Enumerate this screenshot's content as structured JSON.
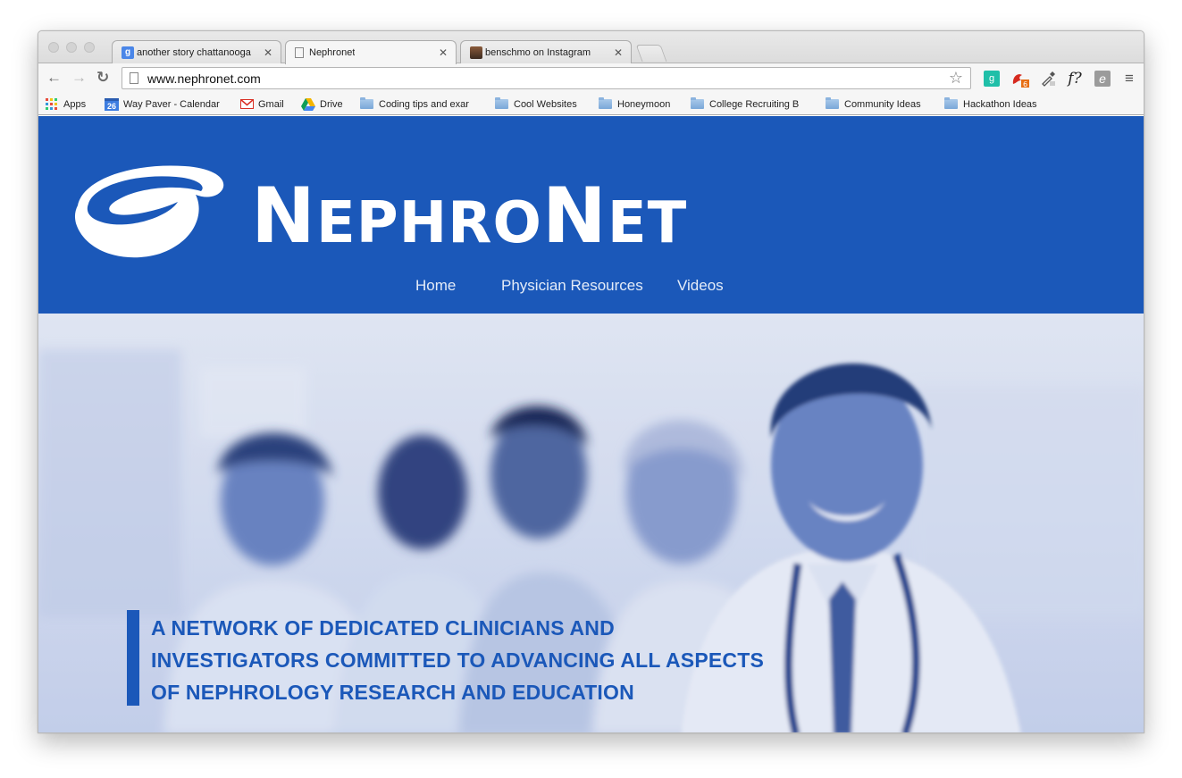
{
  "browser": {
    "tabs": [
      {
        "favicon": "google-icon",
        "title": "another story chattanooga"
      },
      {
        "favicon": "page-icon",
        "title": "Nephronet"
      },
      {
        "favicon": "instagram-icon",
        "title": "benschmo on Instagram"
      }
    ],
    "url": "www.nephronet.com",
    "extension_text": "f?"
  },
  "bookmarks": [
    {
      "label": "Apps",
      "icon": "apps-grid-icon"
    },
    {
      "label": "Way Paver - Calendar",
      "icon": "calendar-icon",
      "icon_text": "26"
    },
    {
      "label": "Gmail",
      "icon": "gmail-icon"
    },
    {
      "label": "Drive",
      "icon": "drive-icon"
    },
    {
      "label": "Coding tips and exar",
      "icon": "folder-icon"
    },
    {
      "label": "Cool Websites",
      "icon": "folder-icon"
    },
    {
      "label": "Honeymoon",
      "icon": "folder-icon"
    },
    {
      "label": "College Recruiting B",
      "icon": "folder-icon"
    },
    {
      "label": "Community Ideas",
      "icon": "folder-icon"
    },
    {
      "label": "Hackathon Ideas",
      "icon": "folder-icon"
    }
  ],
  "site": {
    "brand": {
      "n1": "N",
      "mid1": "EPHRO",
      "n2": "N",
      "mid2": "ET"
    },
    "nav": [
      "Home",
      "Physician Resources",
      "Videos"
    ],
    "tagline": [
      "A NETWORK OF DEDICATED CLINICIANS AND",
      "INVESTIGATORS COMMITTED TO ADVANCING ALL ASPECTS",
      "OF NEPHROLOGY RESEARCH AND EDUCATION"
    ]
  },
  "colors": {
    "brand_blue": "#1b58b9",
    "hero_tint": "#2f5fb8"
  }
}
